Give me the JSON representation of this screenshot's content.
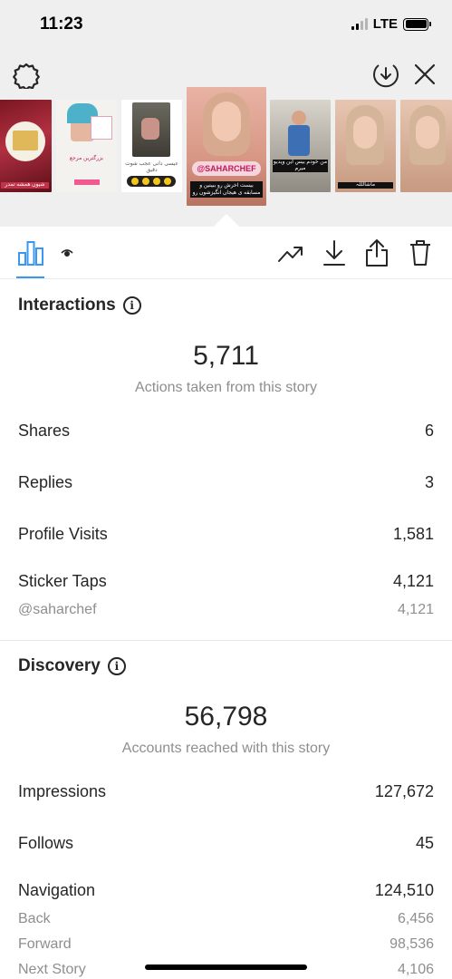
{
  "status_bar": {
    "time": "11:23",
    "network": "LTE"
  },
  "thumbnails": [
    {
      "caption": "شیوں همشه تمدر"
    },
    {
      "caption": "بزرگترین مرجع"
    },
    {
      "caption": "عیسی دانی عجب شوت دقیق"
    },
    {
      "caption": "@SAHARCHEF",
      "sub": "بیست اخرش رو ببینین و مسابقه ی هیجان انگیزشون رو"
    },
    {
      "caption": "من خودم بیس این ویدیو میرم"
    },
    {
      "caption": "ماشالللہ"
    },
    {
      "caption": ""
    }
  ],
  "interactions": {
    "title": "Interactions",
    "total": "5,711",
    "total_caption": "Actions taken from this story",
    "rows": [
      {
        "label": "Shares",
        "value": "6"
      },
      {
        "label": "Replies",
        "value": "3"
      },
      {
        "label": "Profile Visits",
        "value": "1,581"
      },
      {
        "label": "Sticker Taps",
        "value": "4,121"
      },
      {
        "label": "@saharchef",
        "value": "4,121"
      }
    ]
  },
  "discovery": {
    "title": "Discovery",
    "total": "56,798",
    "total_caption": "Accounts reached with this story",
    "rows": [
      {
        "label": "Impressions",
        "value": "127,672"
      },
      {
        "label": "Follows",
        "value": "45"
      },
      {
        "label": "Navigation",
        "value": "124,510"
      },
      {
        "label": "Back",
        "value": "6,456"
      },
      {
        "label": "Forward",
        "value": "98,536"
      },
      {
        "label": "Next Story",
        "value": "4,106"
      }
    ]
  },
  "colors": {
    "accent": "#3897f0",
    "text": "#262626",
    "muted": "#8e8e8e",
    "header_bg": "#efefef"
  }
}
